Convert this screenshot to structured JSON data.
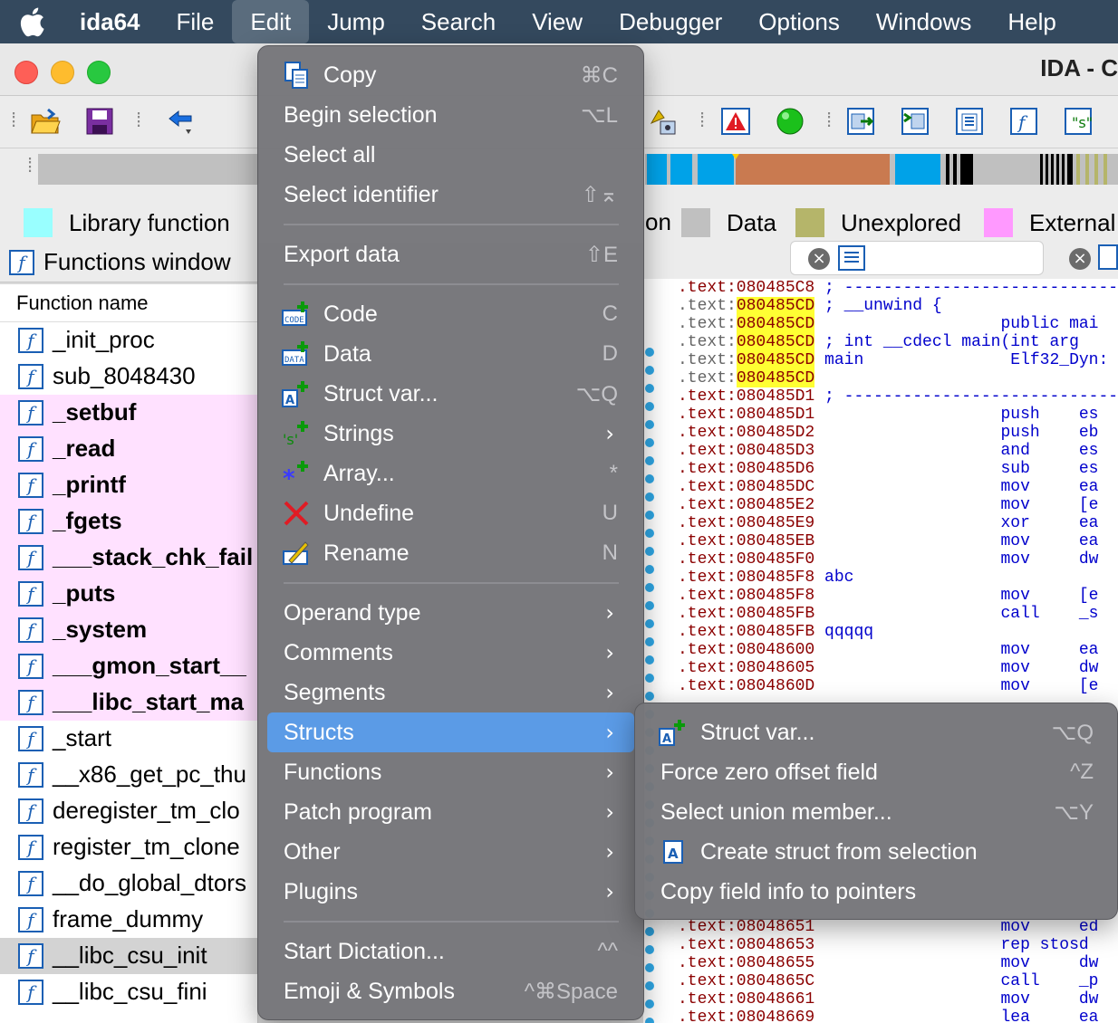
{
  "menubar": {
    "app_name": "ida64",
    "items": [
      "File",
      "Edit",
      "Jump",
      "Search",
      "View",
      "Debugger",
      "Options",
      "Windows",
      "Help"
    ],
    "active": "Edit"
  },
  "window": {
    "title": "IDA - C"
  },
  "legend": {
    "items": [
      {
        "label": "Library function",
        "color": "#99ffff"
      },
      {
        "label": "on",
        "color": ""
      },
      {
        "label": "Data",
        "color": "#c0c0c0"
      },
      {
        "label": "Unexplored",
        "color": "#b5b56a"
      },
      {
        "label": "External",
        "color": "#ff99ff"
      }
    ]
  },
  "functions_window": {
    "title": "Functions window",
    "column_header": "Function name",
    "rows": [
      {
        "name": "_init_proc",
        "kind": "normal"
      },
      {
        "name": "sub_8048430",
        "kind": "normal"
      },
      {
        "name": "_setbuf",
        "kind": "lib"
      },
      {
        "name": "_read",
        "kind": "lib"
      },
      {
        "name": "_printf",
        "kind": "lib"
      },
      {
        "name": "_fgets",
        "kind": "lib"
      },
      {
        "name": "___stack_chk_fail",
        "kind": "lib"
      },
      {
        "name": "_puts",
        "kind": "lib"
      },
      {
        "name": "_system",
        "kind": "lib"
      },
      {
        "name": "___gmon_start__",
        "kind": "lib"
      },
      {
        "name": "___libc_start_ma",
        "kind": "lib"
      },
      {
        "name": "_start",
        "kind": "normal"
      },
      {
        "name": "__x86_get_pc_thu",
        "kind": "normal"
      },
      {
        "name": "deregister_tm_clo",
        "kind": "normal"
      },
      {
        "name": "register_tm_clone",
        "kind": "normal"
      },
      {
        "name": "__do_global_dtors",
        "kind": "normal"
      },
      {
        "name": "frame_dummy",
        "kind": "normal"
      },
      {
        "name": "__libc_csu_init",
        "kind": "sel"
      },
      {
        "name": "__libc_csu_fini",
        "kind": "normal"
      }
    ]
  },
  "disasm": {
    "lines": [
      {
        "addr": ".text:080485C8",
        "style": "plain",
        "rest": " ; -----------------------------"
      },
      {
        "addr": "080485CD",
        "style": "hl",
        "prefix": ".text:",
        "rest": " ; __unwind {"
      },
      {
        "addr": "080485CD",
        "style": "hl",
        "prefix": ".text:",
        "rest": "                   public mai"
      },
      {
        "addr": "080485CD",
        "style": "hl",
        "prefix": ".text:",
        "rest": " ; int __cdecl main(int arg"
      },
      {
        "addr": "080485CD",
        "style": "hl",
        "prefix": ".text:",
        "rest": " main               Elf32_Dyn:"
      },
      {
        "addr": "080485CD",
        "style": "hl",
        "prefix": ".text:",
        "rest": ""
      },
      {
        "addr": ".text:080485D1",
        "style": "plain",
        "rest": " ; -----------------------------"
      },
      {
        "addr": ".text:080485D1",
        "style": "plain",
        "rest": "                   push    es"
      },
      {
        "addr": ".text:080485D2",
        "style": "plain",
        "rest": "                   push    eb"
      },
      {
        "addr": ".text:080485D3",
        "style": "plain",
        "rest": "                   and     es"
      },
      {
        "addr": ".text:080485D6",
        "style": "plain",
        "rest": "                   sub     es"
      },
      {
        "addr": ".text:080485DC",
        "style": "plain",
        "rest": "                   mov     ea"
      },
      {
        "addr": ".text:080485E2",
        "style": "plain",
        "rest": "                   mov     [e"
      },
      {
        "addr": ".text:080485E9",
        "style": "plain",
        "rest": "                   xor     ea"
      },
      {
        "addr": ".text:080485EB",
        "style": "plain",
        "rest": "                   mov     ea"
      },
      {
        "addr": ".text:080485F0",
        "style": "plain",
        "rest": "                   mov     dw"
      },
      {
        "addr": ".text:080485F8",
        "style": "plain",
        "rest": " abc"
      },
      {
        "addr": ".text:080485F8",
        "style": "plain",
        "rest": "                   mov     [e"
      },
      {
        "addr": ".text:080485FB",
        "style": "plain",
        "rest": "                   call    _s"
      },
      {
        "addr": ".text:080485FB",
        "style": "plain",
        "rest": " qqqqq"
      },
      {
        "addr": ".text:08048600",
        "style": "plain",
        "rest": "                   mov     ea"
      },
      {
        "addr": ".text:08048605",
        "style": "plain",
        "rest": "                   mov     dw"
      },
      {
        "addr": ".text:0804860D",
        "style": "plain",
        "rest": "                   mov     [e"
      }
    ],
    "bottom_lines": [
      {
        "addr": ".text:08048651",
        "rest": "                   mov     ed"
      },
      {
        "addr": ".text:08048653",
        "rest": "                   rep stosd"
      },
      {
        "addr": ".text:08048655",
        "rest": "                   mov     dw"
      },
      {
        "addr": ".text:0804865C",
        "rest": "                   call    _p"
      },
      {
        "addr": ".text:08048661",
        "rest": "                   mov     dw"
      },
      {
        "addr": ".text:08048669",
        "rest": "                   lea     ea"
      }
    ]
  },
  "edit_menu": {
    "items": [
      {
        "label": "Copy",
        "shortcut": "⌘C",
        "icon": "copy-icon"
      },
      {
        "label": "Begin selection",
        "shortcut": "⌥L"
      },
      {
        "label": "Select all",
        "shortcut": ""
      },
      {
        "label": "Select identifier",
        "shortcut": "⇧⌅"
      },
      {
        "label": "Export data",
        "shortcut": "⇧E"
      },
      {
        "label": "Code",
        "shortcut": "C",
        "icon": "code-icon"
      },
      {
        "label": "Data",
        "shortcut": "D",
        "icon": "data-icon"
      },
      {
        "label": "Struct var...",
        "shortcut": "⌥Q",
        "icon": "struct-var-icon"
      },
      {
        "label": "Strings",
        "submenu": true,
        "icon": "strings-icon"
      },
      {
        "label": "Array...",
        "shortcut": "*",
        "icon": "array-icon"
      },
      {
        "label": "Undefine",
        "shortcut": "U",
        "icon": "undefine-icon"
      },
      {
        "label": "Rename",
        "shortcut": "N",
        "icon": "rename-icon"
      },
      {
        "label": "Operand type",
        "submenu": true
      },
      {
        "label": "Comments",
        "submenu": true
      },
      {
        "label": "Segments",
        "submenu": true
      },
      {
        "label": "Structs",
        "submenu": true,
        "highlighted": true
      },
      {
        "label": "Functions",
        "submenu": true
      },
      {
        "label": "Patch program",
        "submenu": true
      },
      {
        "label": "Other",
        "submenu": true
      },
      {
        "label": "Plugins",
        "submenu": true
      },
      {
        "label": "Start Dictation...",
        "shortcut": "^^"
      },
      {
        "label": "Emoji & Symbols",
        "shortcut": "^⌘Space"
      }
    ]
  },
  "structs_submenu": {
    "items": [
      {
        "label": "Struct var...",
        "shortcut": "⌥Q",
        "icon": "struct-var-icon"
      },
      {
        "label": "Force zero offset field",
        "shortcut": "^Z"
      },
      {
        "label": "Select union member...",
        "shortcut": "⌥Y"
      },
      {
        "label": "Create struct from selection",
        "shortcut": "",
        "icon": "create-struct-icon"
      },
      {
        "label": "Copy field info to pointers",
        "shortcut": ""
      }
    ]
  },
  "colors": {
    "menubar_bg": "#34495e",
    "menu_bg": "#76767a",
    "menu_highlight": "#5b9be6",
    "lib_row_bg": "#ffe1ff",
    "addr_color": "#8b0000",
    "addr_highlight": "#ffff33"
  }
}
